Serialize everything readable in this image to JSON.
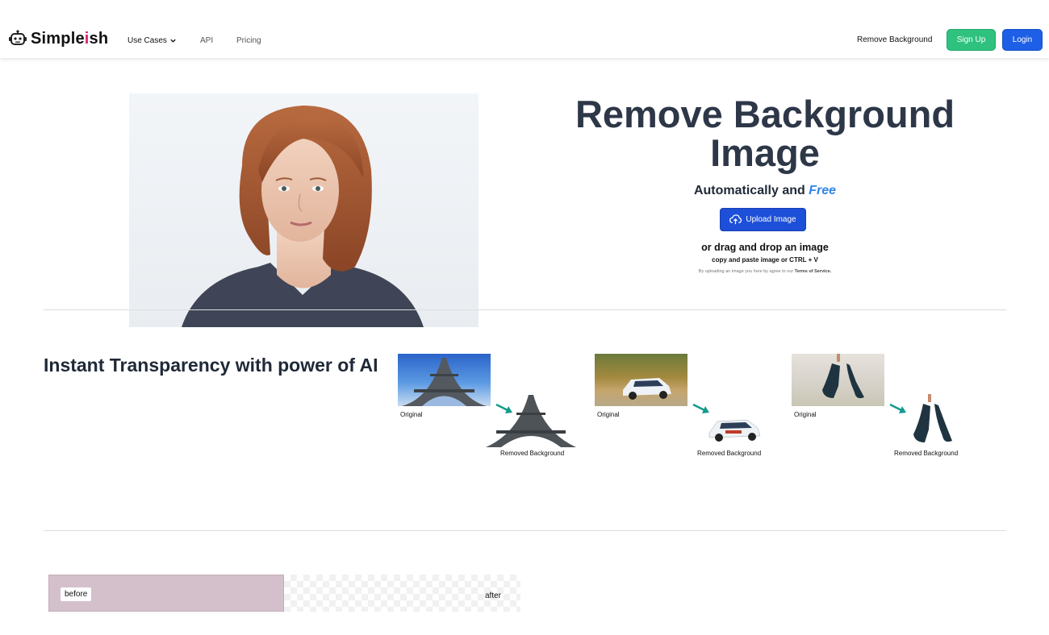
{
  "header": {
    "logo": {
      "prefix": "Simple",
      "accent": "i",
      "suffix": "sh"
    },
    "nav": {
      "use_cases": "Use Cases",
      "api": "API",
      "pricing": "Pricing"
    },
    "remove_background": "Remove Background",
    "sign_up": "Sign Up",
    "login": "Login"
  },
  "hero": {
    "title": "Remove Background Image",
    "subtitle_prefix": "Automatically and",
    "subtitle_accent": "Free",
    "upload_button": "Upload Image",
    "drag_text": "or drag and drop an image",
    "paste_text": "copy and paste image or CTRL + V",
    "tos_prefix": "By uploading an image you here by agree to our",
    "tos_link": "Terms of Service."
  },
  "transparency": {
    "title": "Instant Transparency with power of AI",
    "examples": [
      {
        "icon": "eiffel-tower",
        "original_label": "Original",
        "removed_label": "Removed Background"
      },
      {
        "icon": "rally-car",
        "original_label": "Original",
        "removed_label": "Removed Background"
      },
      {
        "icon": "high-heels",
        "original_label": "Original",
        "removed_label": "Removed Background"
      }
    ]
  },
  "before_after": {
    "before_label": "before",
    "after_label": "after"
  },
  "colors": {
    "accent_pink": "#e11d74",
    "free_blue": "#2f86e8",
    "signup_green": "#2ec27e",
    "login_blue": "#1d5fe6",
    "upload_blue": "#1d4fd8",
    "arrow_teal": "#139a8a"
  }
}
